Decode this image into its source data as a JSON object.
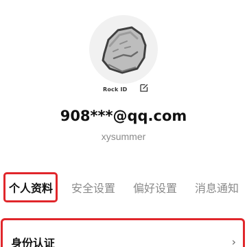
{
  "profile": {
    "avatar_label": "Rock ID",
    "email": "908***@qq.com",
    "username": "xysummer"
  },
  "tabs": [
    {
      "label": "个人资料",
      "active": true
    },
    {
      "label": "安全设置",
      "active": false
    },
    {
      "label": "偏好设置",
      "active": false
    },
    {
      "label": "消息通知",
      "active": false
    }
  ],
  "section": {
    "title": "身份认证",
    "chevron": "›"
  },
  "colors": {
    "highlight": "#e0262b",
    "muted_text": "#8a8a8a"
  },
  "icons": {
    "avatar": "rock-avatar-icon",
    "edit": "edit-icon",
    "chevron": "chevron-right-icon"
  }
}
